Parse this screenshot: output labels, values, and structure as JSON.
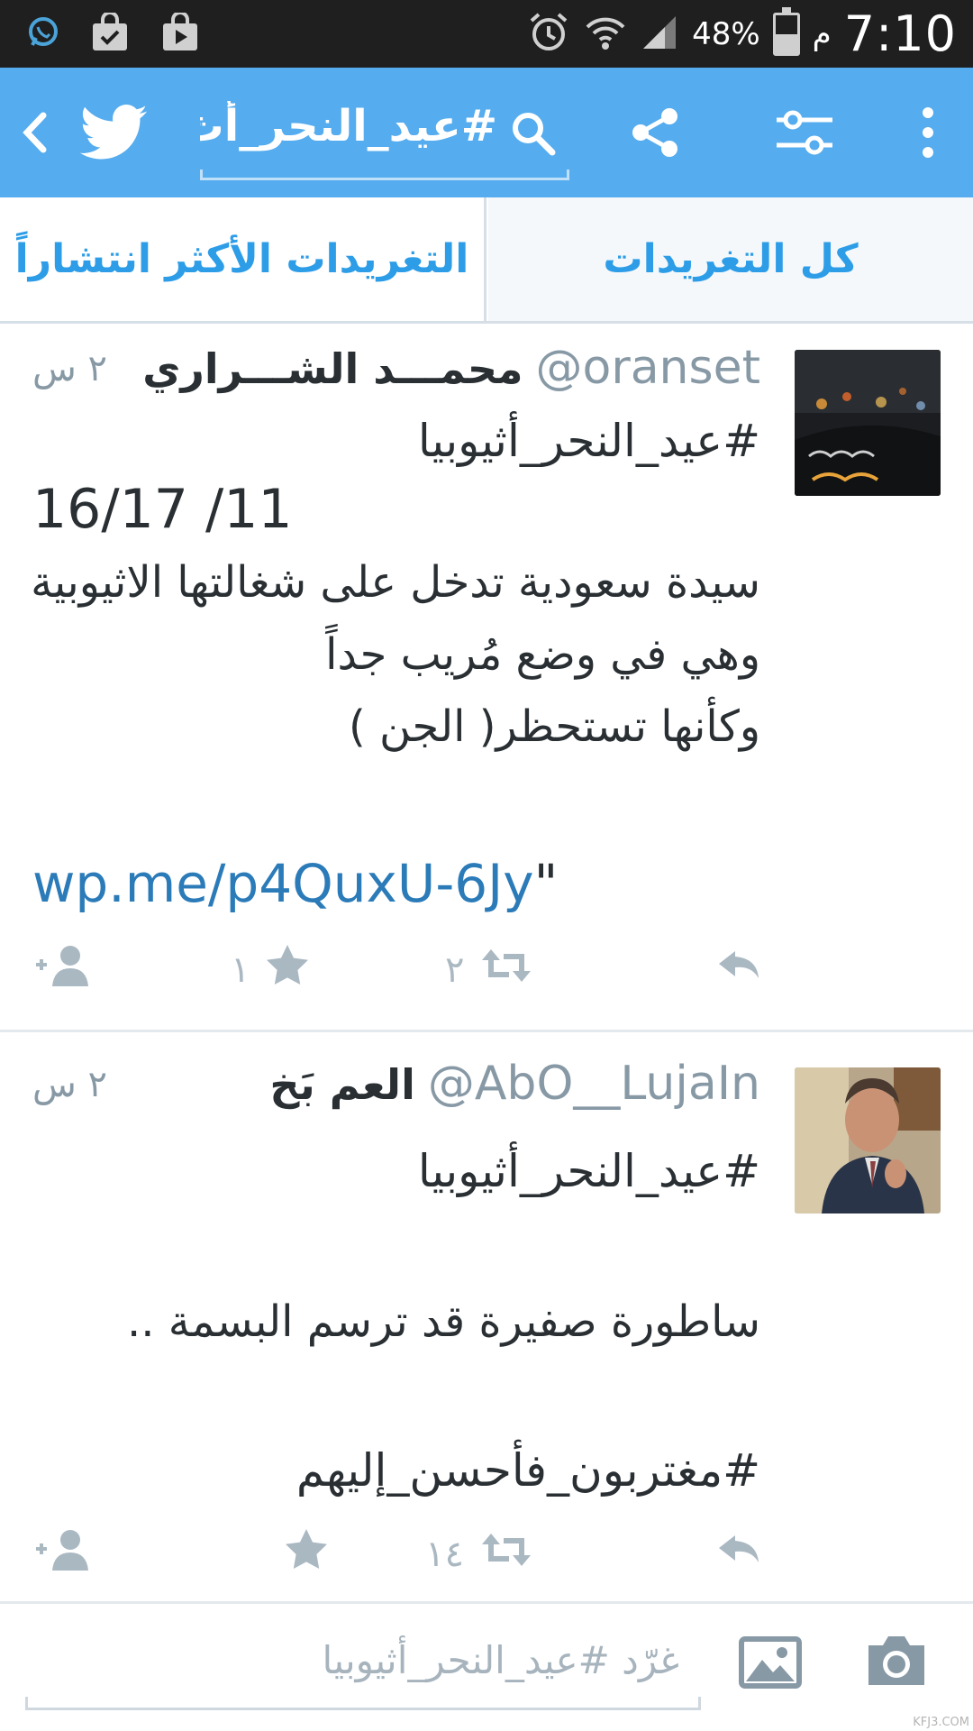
{
  "status_bar": {
    "time": "7:10",
    "ampm": "م",
    "battery": "48%",
    "battery_level": 0.48,
    "icons": [
      "whatsapp-icon",
      "shopping-bag-check-icon",
      "play-store-icon",
      "alarm-icon",
      "wifi-icon",
      "signal-icon",
      "battery-icon"
    ]
  },
  "app_bar": {
    "search_query": "#عيد_النحر_أث",
    "icons": [
      "back-icon",
      "twitter-bird-icon",
      "search-icon",
      "share-icon",
      "filter-icon",
      "more-icon"
    ],
    "color": "#55acee"
  },
  "tabs": {
    "all": "كل التغريدات",
    "top": "التغريدات الأكثر انتشاراً"
  },
  "tweets": [
    {
      "display_name": "محمـــد الشـــراري",
      "handle": "@oranset",
      "time": "٢ س",
      "lines": [
        "#عيد_النحر_أثيوبيا"
      ],
      "date_line": "16/17 /11",
      "body": [
        "سيدة سعودية تدخل على شغالتها الاثيوبية",
        "وهي في وضع مُريب جداً",
        "وكأنها تستحظر( الجن )"
      ],
      "link": "wp.me/p4QuxU-6Jy",
      "link_suffix": "\"",
      "retweets": "٢",
      "favorites": "١"
    },
    {
      "display_name": "العم بَخ",
      "handle": "@AbO__LujaIn",
      "time": "٢ س",
      "lines": [
        "#عيد_النحر_أثيوبيا",
        "ساطورة صفيرة قد ترسم البسمة ..",
        "#مغتربون_فأحسن_إليهم"
      ],
      "retweets": "١٤",
      "favorites": ""
    }
  ],
  "compose": {
    "placeholder": "غرّد #عيد_النحر_أثيوبيا"
  },
  "watermark": "KFJ3.COM"
}
